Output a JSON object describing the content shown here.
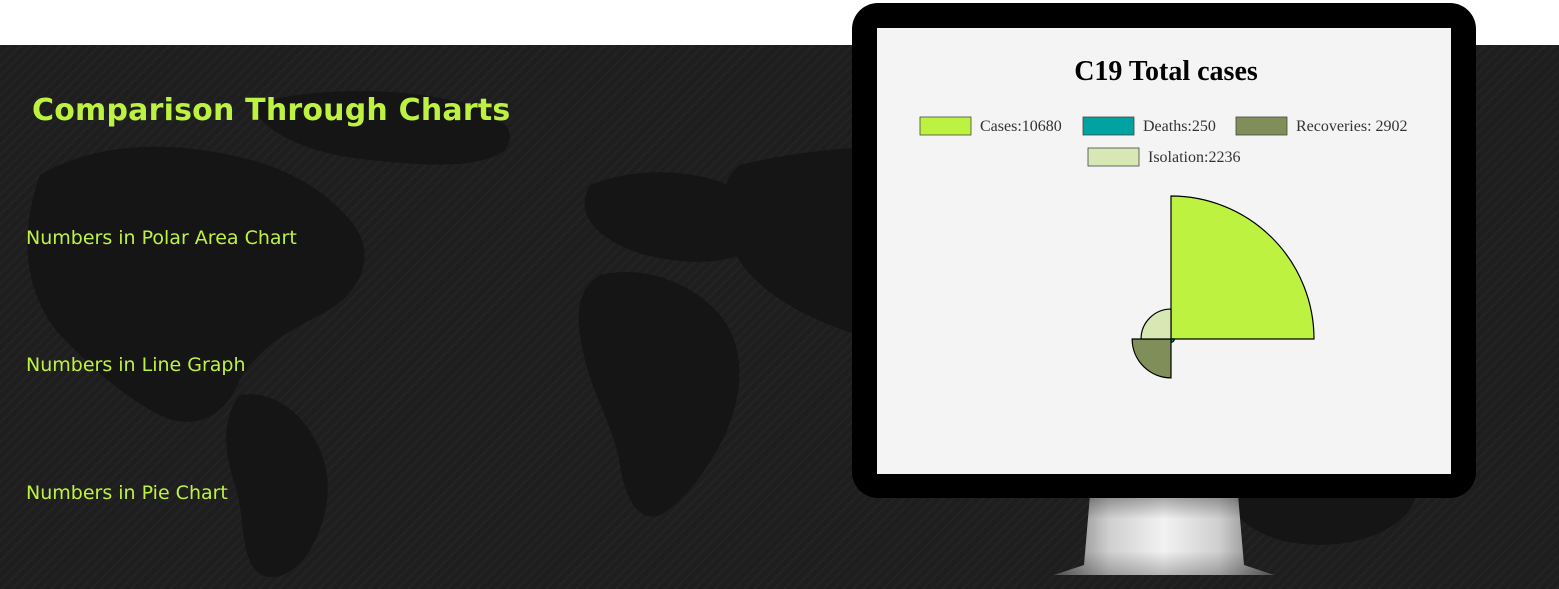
{
  "page": {
    "section_title": "Comparison Through Charts",
    "links": [
      {
        "label": "Numbers in Polar Area Chart"
      },
      {
        "label": "Numbers in Line Graph"
      },
      {
        "label": "Numbers in Pie Chart"
      }
    ]
  },
  "colors": {
    "accent": "#bef241",
    "background_dark": "#1e1e1e",
    "monitor_frame": "#000000",
    "screen_bg": "#f4f4f4"
  },
  "chart_data": {
    "type": "polar-area",
    "title": "C19 Total cases",
    "legend_position": "top",
    "series": [
      {
        "name": "Cases:10680",
        "value": 10680,
        "color": "#bef241"
      },
      {
        "name": "Deaths:250",
        "value": 250,
        "color": "#00a2a2"
      },
      {
        "name": "Recoveries: 2902",
        "value": 2902,
        "color": "#808e59"
      },
      {
        "name": "Isolation:2236",
        "value": 2236,
        "color": "#d8e8b5"
      }
    ],
    "r_max": 10680,
    "r_scale": "linear",
    "grid": false
  }
}
